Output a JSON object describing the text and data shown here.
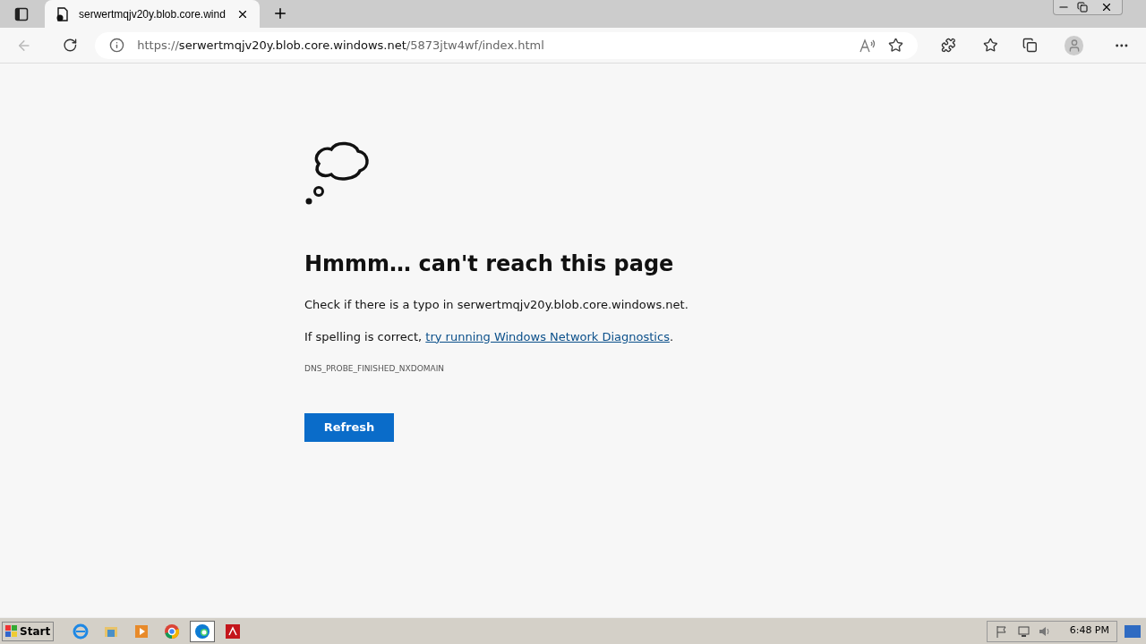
{
  "tab": {
    "title": "serwertmqjv20y.blob.core.wind",
    "selected": true
  },
  "address": {
    "scheme": "https://",
    "host": "serwertmqjv20y.blob.core.windows.net",
    "path": "/5873jtw4wf/index.html"
  },
  "error": {
    "heading": "Hmmm… can't reach this page",
    "line1": "Check if there is a typo in serwertmqjv20y.blob.core.windows.net.",
    "line2_before": "If spelling is correct, ",
    "line2_link": "try running Windows Network Diagnostics",
    "line2_after": ".",
    "code": "DNS_PROBE_FINISHED_NXDOMAIN",
    "button": "Refresh"
  },
  "taskbar": {
    "start": "Start",
    "apps": [
      {
        "kind": "ie",
        "selected": false
      },
      {
        "kind": "folder",
        "selected": false
      },
      {
        "kind": "media",
        "selected": false
      },
      {
        "kind": "chrome",
        "selected": false
      },
      {
        "kind": "edge",
        "selected": true
      },
      {
        "kind": "pdf",
        "selected": false
      }
    ],
    "clock": "6:48 PM"
  }
}
